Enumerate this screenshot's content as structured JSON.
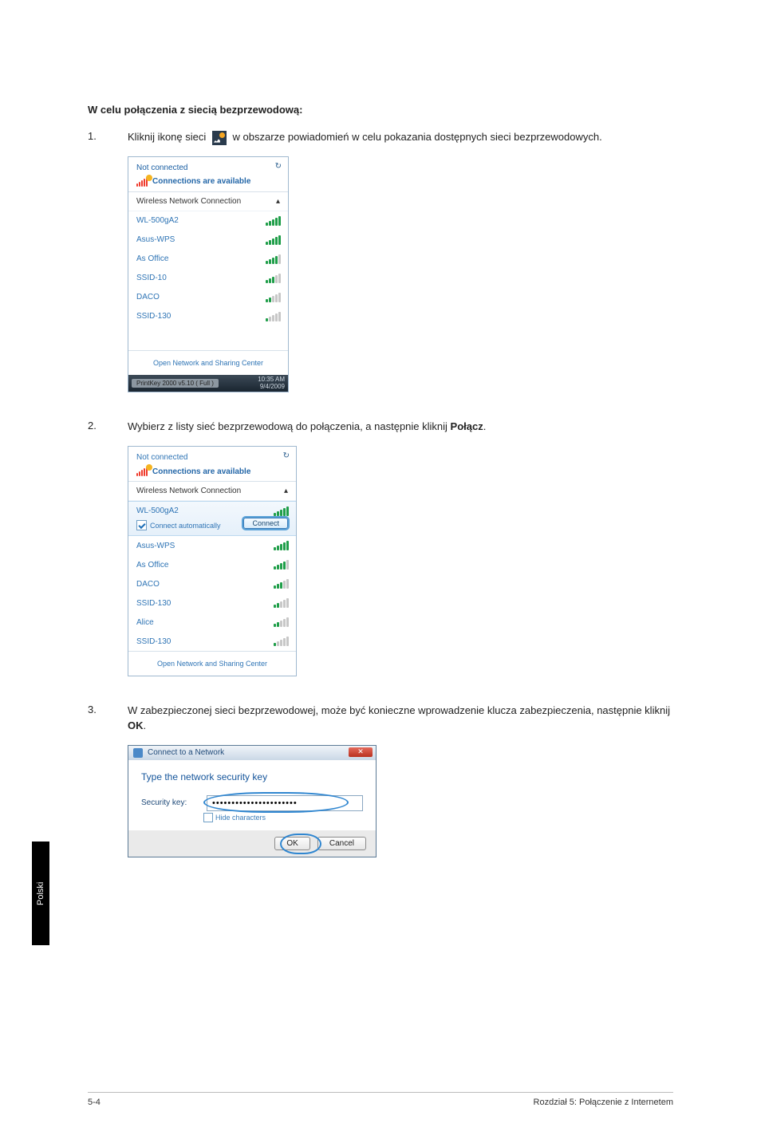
{
  "heading": "W celu połączenia z siecią bezprzewodową:",
  "step1": {
    "num": "1.",
    "pre": "Kliknij ikonę sieci ",
    "post": " w obszarze powiadomień w celu pokazania dostępnych sieci bezprzewodowych."
  },
  "popup1": {
    "title": "Not connected",
    "available": "Connections are available",
    "refresh_glyph": "↻",
    "section_title": "Wireless Network Connection",
    "collapse_glyph": "▴",
    "items": [
      {
        "name": "WL-500gA2",
        "strength": "s5"
      },
      {
        "name": "Asus-WPS",
        "strength": "s5"
      },
      {
        "name": "As Office",
        "strength": "s4"
      },
      {
        "name": "SSID-10",
        "strength": "s3"
      },
      {
        "name": "DACO",
        "strength": "s2"
      },
      {
        "name": "SSID-130",
        "strength": "s1"
      }
    ],
    "footer_link": "Open Network and Sharing Center",
    "taskbar_app": "PrintKey 2000  v5.10 ( Full )",
    "taskbar_time": "10:35 AM",
    "taskbar_date": "9/4/2009"
  },
  "step2": {
    "num": "2.",
    "body_pre": "Wybierz z listy sieć bezprzewodową do połączenia, a następnie kliknij ",
    "body_bold": "Połącz",
    "body_post": "."
  },
  "popup2": {
    "title": "Not connected",
    "available": "Connections are available",
    "section_title": "Wireless Network Connection",
    "collapse_glyph": "▴",
    "selected": {
      "name": "WL-500gA2",
      "auto_label": "Connect automatically",
      "connect_btn": "Connect"
    },
    "items": [
      {
        "name": "Asus-WPS",
        "strength": "s5"
      },
      {
        "name": "As Office",
        "strength": "s4"
      },
      {
        "name": "DACO",
        "strength": "s3"
      },
      {
        "name": "SSID-130",
        "strength": "s2"
      },
      {
        "name": "Alice",
        "strength": "s2"
      },
      {
        "name": "SSID-130",
        "strength": "s1"
      }
    ],
    "footer_link": "Open Network and Sharing Center"
  },
  "step3": {
    "num": "3.",
    "body_pre": "W zabezpieczonej sieci bezprzewodowej, może być konieczne wprowadzenie klucza zabezpieczenia, następnie kliknij ",
    "body_bold": "OK",
    "body_post": "."
  },
  "dialog": {
    "title": "Connect to a Network",
    "close_glyph": "✕",
    "prompt": "Type the network security key",
    "field_label": "Security key:",
    "field_value": "••••••••••••••••••••••",
    "hide_label": "Hide characters",
    "ok": "OK",
    "cancel": "Cancel"
  },
  "side_tab": "Polski",
  "footer": {
    "page": "5-4",
    "chapter": "Rozdział 5: Połączenie z Internetem"
  }
}
